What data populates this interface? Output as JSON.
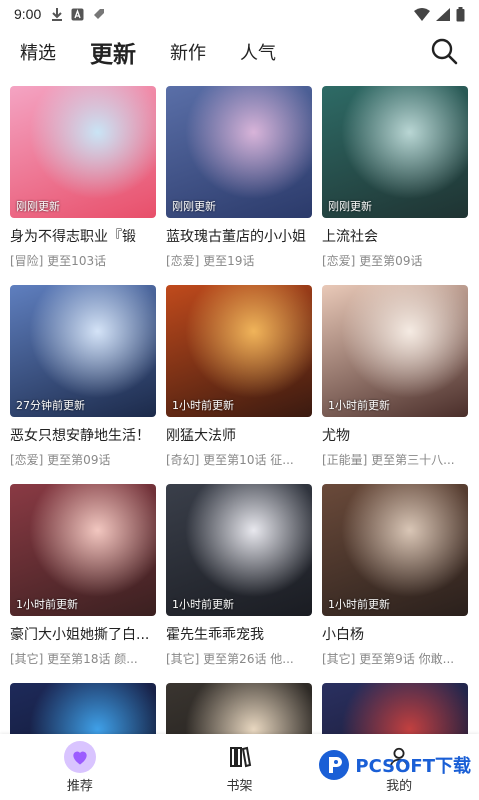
{
  "status_bar": {
    "time": "9:00"
  },
  "tabs": [
    {
      "label": "精选",
      "active": false
    },
    {
      "label": "更新",
      "active": true
    },
    {
      "label": "新作",
      "active": false
    },
    {
      "label": "人气",
      "active": false
    }
  ],
  "cards": [
    {
      "title": "身为不得志职业『锻",
      "sub": "[冒险] 更至103话",
      "badge": "刚刚更新",
      "colors": [
        "#f4a4c3",
        "#c9e4f5",
        "#e84f6a"
      ]
    },
    {
      "title": "蓝玫瑰古董店的小小姐",
      "sub": "[恋爱] 更至19话",
      "badge": "刚刚更新",
      "colors": [
        "#5a6fa8",
        "#d8b4d9",
        "#2b3a6a"
      ]
    },
    {
      "title": "上流社会",
      "sub": "[恋爱] 更至第09话",
      "badge": "刚刚更新",
      "colors": [
        "#2e6b66",
        "#b9d6d4",
        "#1f3332"
      ]
    },
    {
      "title": "恶女只想安静地生活！",
      "sub": "[恋爱] 更至第09话",
      "badge": "27分钟前更新",
      "colors": [
        "#5f7fbf",
        "#d4e3f7",
        "#1c2a4a"
      ]
    },
    {
      "title": "刚猛大法师",
      "sub": "[奇幻] 更至第10话 征...",
      "badge": "1小时前更新",
      "colors": [
        "#c04a1c",
        "#f0b45a",
        "#3a1a10"
      ]
    },
    {
      "title": "尤物",
      "sub": "[正能量] 更至第三十八...",
      "badge": "1小时前更新",
      "colors": [
        "#e9c9b8",
        "#f5ebe3",
        "#4a2e2a"
      ]
    },
    {
      "title": "豪门大小姐她撕了白...",
      "sub": "[其它] 更至第18话 颜...",
      "badge": "1小时前更新",
      "colors": [
        "#8a3a44",
        "#f2c7c0",
        "#3a2020"
      ]
    },
    {
      "title": "霍先生乖乖宠我",
      "sub": "[其它] 更至第26话 他...",
      "badge": "1小时前更新",
      "colors": [
        "#3a3f4a",
        "#e8e8ee",
        "#1a1c22"
      ]
    },
    {
      "title": "小白杨",
      "sub": "[其它] 更至第9话 你敢...",
      "badge": "1小时前更新",
      "colors": [
        "#6a4a3a",
        "#d9c6b6",
        "#2a201c"
      ]
    },
    {
      "title": "",
      "sub": "",
      "badge": "",
      "colors": [
        "#1e2a5a",
        "#3fa0e8",
        "#0a0f22"
      ]
    },
    {
      "title": "",
      "sub": "",
      "badge": "",
      "colors": [
        "#3a3530",
        "#e8d7c0",
        "#151311"
      ]
    },
    {
      "title": "",
      "sub": "",
      "badge": "",
      "colors": [
        "#2a3060",
        "#c24040",
        "#120f20"
      ]
    }
  ],
  "bottom_nav": [
    {
      "label": "推荐",
      "icon": "heart-icon",
      "active": true
    },
    {
      "label": "书架",
      "icon": "bookshelf-icon",
      "active": false
    },
    {
      "label": "我的",
      "icon": "user-icon",
      "active": false
    }
  ],
  "watermark": {
    "text": "PCSOFT下载"
  },
  "colors": {
    "accent": "#9b5cff",
    "accent_light": "#d9c4ff"
  }
}
